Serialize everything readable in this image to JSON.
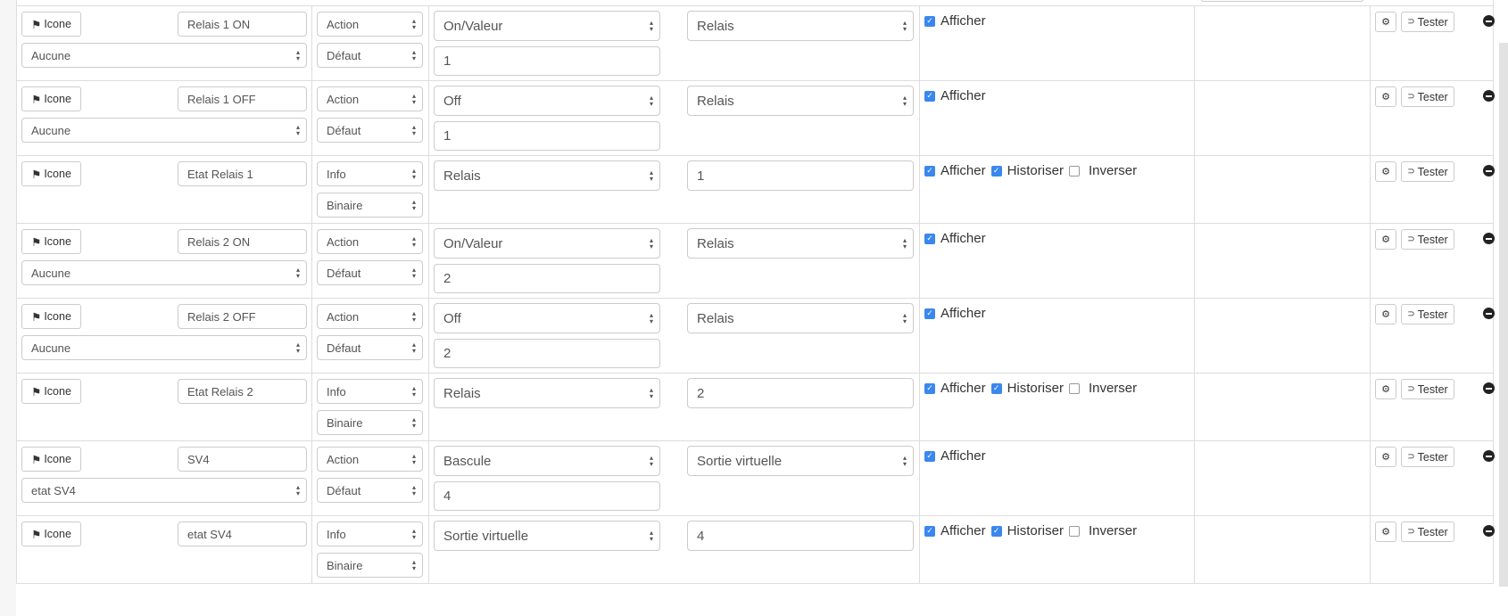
{
  "labels": {
    "icon_button": "Icone",
    "display": "Afficher",
    "historize": "Historiser",
    "invert": "Inverser",
    "test_button": "Tester"
  },
  "icons": {
    "icon_button": "flag-icon",
    "config": "gears-icon",
    "test": "rss-icon",
    "remove": "minus-circle-icon"
  },
  "colors": {
    "checkbox_checked": "#3b87f0",
    "border": "#dddddd"
  },
  "commands": [
    {
      "name": "Relais 1 ON",
      "type": "Action",
      "subtype": "Défaut",
      "value_cmd": "Aucune",
      "kind": "On/Valeur",
      "target": "Relais",
      "number": "1",
      "display": true
    },
    {
      "name": "Relais 1 OFF",
      "type": "Action",
      "subtype": "Défaut",
      "value_cmd": "Aucune",
      "kind": "Off",
      "target": "Relais",
      "number": "1",
      "display": true
    },
    {
      "name": "Etat Relais 1",
      "type": "Info",
      "subtype": "Binaire",
      "kind": "Relais",
      "number": "1",
      "display": true,
      "historize": true,
      "invert": false
    },
    {
      "name": "Relais 2 ON",
      "type": "Action",
      "subtype": "Défaut",
      "value_cmd": "Aucune",
      "kind": "On/Valeur",
      "target": "Relais",
      "number": "2",
      "display": true
    },
    {
      "name": "Relais 2 OFF",
      "type": "Action",
      "subtype": "Défaut",
      "value_cmd": "Aucune",
      "kind": "Off",
      "target": "Relais",
      "number": "2",
      "display": true
    },
    {
      "name": "Etat Relais 2",
      "type": "Info",
      "subtype": "Binaire",
      "kind": "Relais",
      "number": "2",
      "display": true,
      "historize": true,
      "invert": false
    },
    {
      "name": "SV4",
      "type": "Action",
      "subtype": "Défaut",
      "value_cmd": "etat SV4",
      "kind": "Bascule",
      "target": "Sortie virtuelle",
      "number": "4",
      "display": true
    },
    {
      "name": "etat SV4",
      "type": "Info",
      "subtype": "Binaire",
      "kind": "Sortie virtuelle",
      "number": "4",
      "display": true,
      "historize": true,
      "invert": false
    }
  ]
}
